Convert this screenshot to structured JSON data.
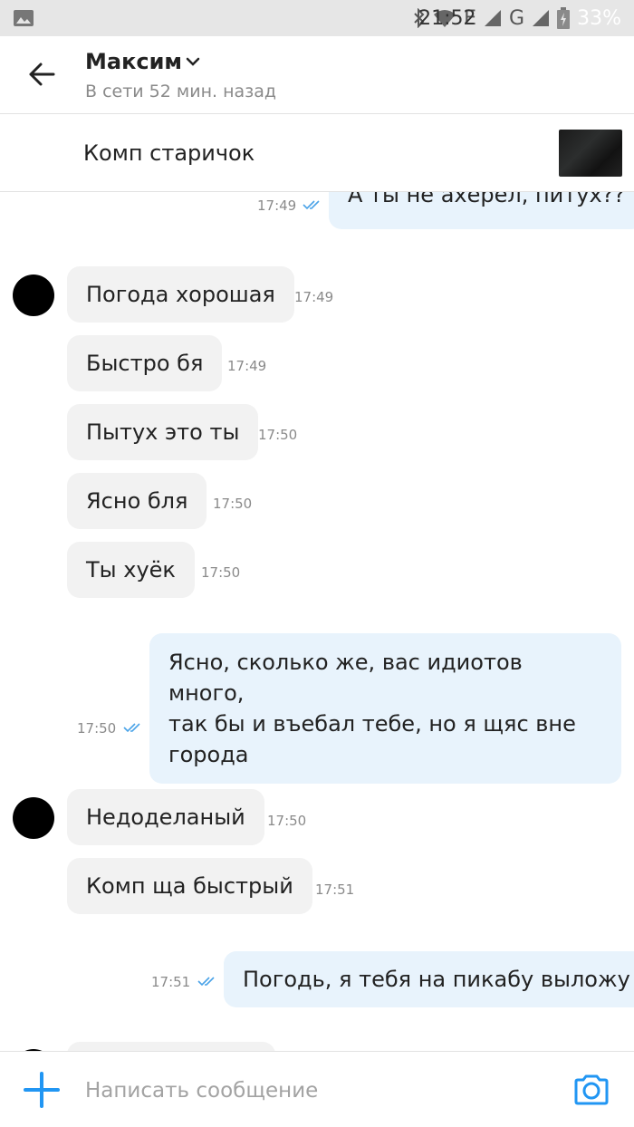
{
  "status_bar": {
    "network_e": "E",
    "network_g": "G",
    "battery": "33%",
    "time": "21:52"
  },
  "header": {
    "name": "Максим",
    "status": "В сети 52 мин. назад"
  },
  "pinned": {
    "title": "Комп старичок"
  },
  "messages": {
    "m0": {
      "text": "А ты не ахерел, питух??",
      "time": "17:49"
    },
    "m1": {
      "text": "Погода хорошая",
      "time": "17:49"
    },
    "m2": {
      "text": "Быстро бя",
      "time": "17:49"
    },
    "m3": {
      "text": "Пытух это ты",
      "time": "17:50"
    },
    "m4": {
      "text": "Ясно бля",
      "time": "17:50"
    },
    "m5": {
      "text": "Ты хуёк",
      "time": "17:50"
    },
    "m6": {
      "line1": "Ясно, сколько же, вас идиотов много,",
      "line2": "так бы и въебал тебе, но я щяс вне",
      "line3": "города",
      "time": "17:50"
    },
    "m7": {
      "text": "Недоделаный",
      "time": "17:50"
    },
    "m8": {
      "text": "Комп ща быстрый",
      "time": "17:51"
    },
    "m9": {
      "text": "Погодь, я тебя на пикабу выложу",
      "time": "17:51"
    }
  },
  "composer": {
    "placeholder": "Написать сообщение"
  },
  "colors": {
    "accent": "#2196f3",
    "incoming_bubble": "#f2f2f2",
    "outgoing_bubble": "#e8f3fc",
    "read_check": "#4aa3e8"
  },
  "icons": [
    "image-icon",
    "bluetooth-icon",
    "wifi-icon",
    "signal-icon",
    "battery-icon",
    "back-arrow-icon",
    "chevron-down-icon",
    "double-check-icon",
    "plus-icon",
    "camera-icon"
  ]
}
